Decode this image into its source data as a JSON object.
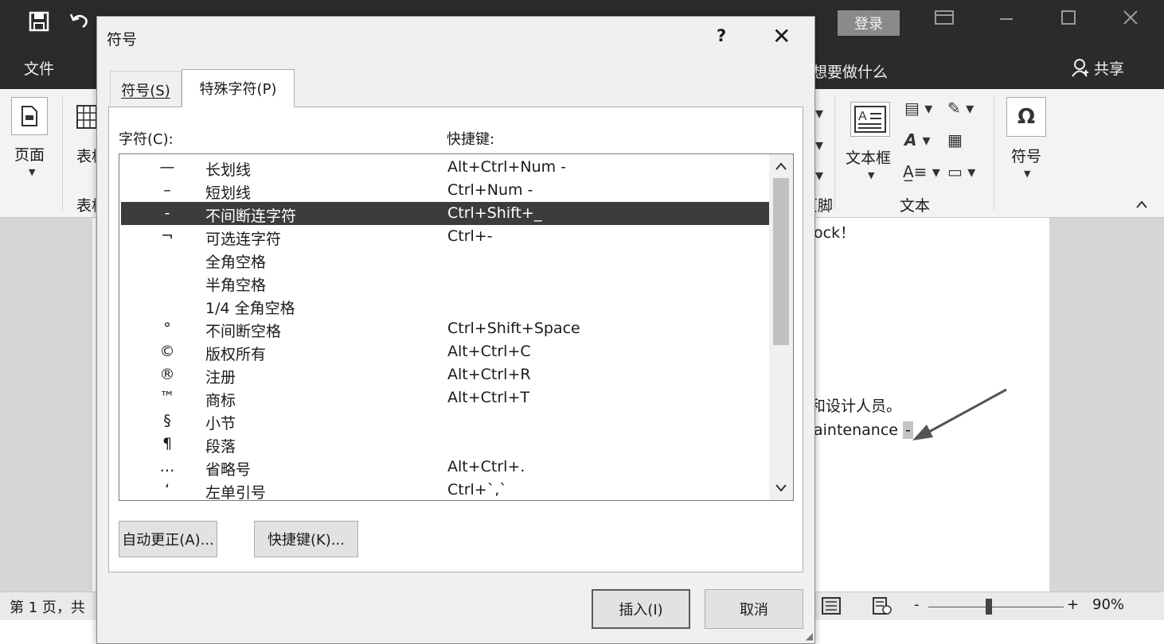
{
  "app": {
    "login_label": "登录",
    "menu_file": "文件",
    "tell_me": "想要做什么",
    "share_label": "共享"
  },
  "ribbon": {
    "page_label": "页面",
    "table_label": "表格",
    "table_group": "表格",
    "header_group": "页眉和页脚",
    "textbox_label": "文本框",
    "text_group": "文本",
    "symbol_label": "符号"
  },
  "document": {
    "line1": "ock！",
    "line2": "和设计人员。",
    "line3": "aintenance",
    "hyphen": "-"
  },
  "status": {
    "page_info": "第 1 页，共",
    "zoom_minus": "-",
    "zoom_plus": "+",
    "zoom_level": "90%"
  },
  "dialog": {
    "title": "符号",
    "help": "?",
    "close": "✕",
    "tabs": [
      {
        "label": "符号(S)",
        "active": false
      },
      {
        "label": "特殊字符(P)",
        "active": true
      }
    ],
    "col_char": "字符(C):",
    "col_shortcut": "快捷键:",
    "rows": [
      {
        "char": "—",
        "name": "长划线",
        "shortcut": "Alt+Ctrl+Num -",
        "selected": false
      },
      {
        "char": "–",
        "name": "短划线",
        "shortcut": "Ctrl+Num -",
        "selected": false
      },
      {
        "char": "-",
        "name": "不间断连字符",
        "shortcut": "Ctrl+Shift+_",
        "selected": true
      },
      {
        "char": "¬",
        "name": "可选连字符",
        "shortcut": "Ctrl+-",
        "selected": false
      },
      {
        "char": "",
        "name": "全角空格",
        "shortcut": "",
        "selected": false
      },
      {
        "char": "",
        "name": "半角空格",
        "shortcut": "",
        "selected": false
      },
      {
        "char": "",
        "name": "1/4 全角空格",
        "shortcut": "",
        "selected": false
      },
      {
        "char": "°",
        "name": "不间断空格",
        "shortcut": "Ctrl+Shift+Space",
        "selected": false
      },
      {
        "char": "©",
        "name": "版权所有",
        "shortcut": "Alt+Ctrl+C",
        "selected": false
      },
      {
        "char": "®",
        "name": "注册",
        "shortcut": "Alt+Ctrl+R",
        "selected": false
      },
      {
        "char": "™",
        "name": "商标",
        "shortcut": "Alt+Ctrl+T",
        "selected": false
      },
      {
        "char": "§",
        "name": "小节",
        "shortcut": "",
        "selected": false
      },
      {
        "char": "¶",
        "name": "段落",
        "shortcut": "",
        "selected": false
      },
      {
        "char": "…",
        "name": "省略号",
        "shortcut": "Alt+Ctrl+.",
        "selected": false
      },
      {
        "char": "‘",
        "name": "左单引号",
        "shortcut": "Ctrl+`,`",
        "selected": false
      }
    ],
    "btn_autocorrect": "自动更正(A)...",
    "btn_shortcut": "快捷键(K)...",
    "btn_insert": "插入(I)",
    "btn_cancel": "取消"
  }
}
